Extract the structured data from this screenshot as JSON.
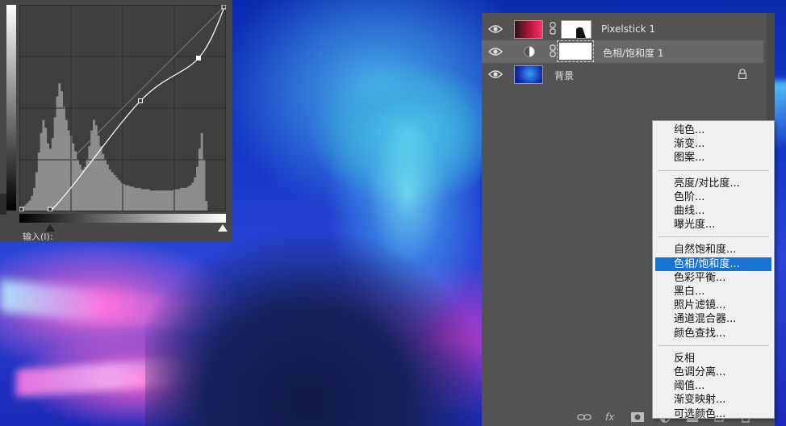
{
  "curves": {
    "input_label": "输入(I):",
    "histogram": [
      2,
      3,
      4,
      6,
      8,
      12,
      18,
      30,
      45,
      60,
      70,
      64,
      52,
      48,
      56,
      72,
      88,
      98,
      92,
      80,
      70,
      62,
      58,
      52,
      46,
      40,
      36,
      32,
      34,
      40,
      50,
      62,
      70,
      66,
      58,
      50,
      44,
      40,
      36,
      32,
      30,
      28,
      26,
      24,
      22,
      21,
      20,
      20,
      19,
      19,
      18,
      18,
      18,
      17,
      17,
      17,
      17,
      16,
      16,
      16,
      16,
      16,
      16,
      16,
      16,
      16,
      16,
      17,
      17,
      17,
      18,
      18,
      18,
      19,
      20,
      22,
      26,
      34,
      48,
      60,
      40,
      8,
      0,
      0,
      0,
      0,
      0,
      0,
      0,
      0
    ],
    "curve_points": [
      [
        0,
        0
      ],
      [
        38,
        0
      ],
      [
        150,
        137
      ],
      [
        222,
        190
      ],
      [
        255,
        255
      ]
    ]
  },
  "layers": [
    {
      "name": "Pixelstick 1",
      "selected": false,
      "type": "smart"
    },
    {
      "name": "色相/饱和度 1",
      "selected": true,
      "type": "adjustment"
    },
    {
      "name": "背景",
      "selected": false,
      "type": "background",
      "locked": true
    }
  ],
  "footer_icons": [
    "link-icon",
    "fx-icon",
    "mask-icon",
    "adjustment-icon",
    "folder-icon",
    "new-layer-icon",
    "trash-icon"
  ],
  "footer_fx_label": "fx",
  "menu": {
    "groups": [
      [
        "纯色...",
        "渐变...",
        "图案..."
      ],
      [
        "亮度/对比度...",
        "色阶...",
        "曲线...",
        "曝光度..."
      ],
      [
        "自然饱和度...",
        "色相/饱和度...",
        "色彩平衡...",
        "黑白...",
        "照片滤镜...",
        "通道混合器...",
        "颜色查找..."
      ],
      [
        "反相",
        "色调分离...",
        "阈值...",
        "渐变映射...",
        "可选颜色..."
      ]
    ],
    "active_item": "色相/饱和度..."
  },
  "colors": {
    "menu_highlight": "#1773d6",
    "panel_bg": "#535353",
    "curves_bg": "#484848"
  }
}
